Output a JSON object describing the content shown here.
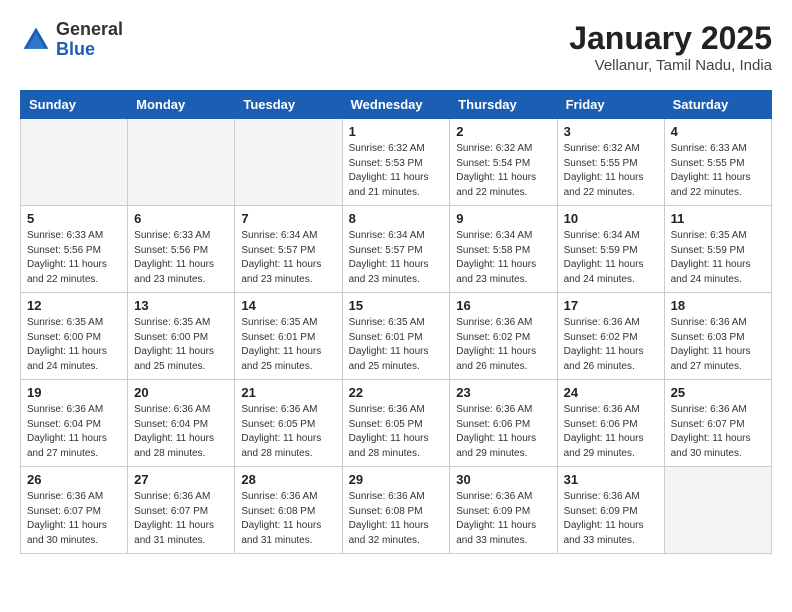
{
  "header": {
    "logo_line1": "General",
    "logo_line2": "Blue",
    "title": "January 2025",
    "subtitle": "Vellanur, Tamil Nadu, India"
  },
  "weekdays": [
    "Sunday",
    "Monday",
    "Tuesday",
    "Wednesday",
    "Thursday",
    "Friday",
    "Saturday"
  ],
  "weeks": [
    [
      {
        "day": "",
        "info": ""
      },
      {
        "day": "",
        "info": ""
      },
      {
        "day": "",
        "info": ""
      },
      {
        "day": "1",
        "info": "Sunrise: 6:32 AM\nSunset: 5:53 PM\nDaylight: 11 hours\nand 21 minutes."
      },
      {
        "day": "2",
        "info": "Sunrise: 6:32 AM\nSunset: 5:54 PM\nDaylight: 11 hours\nand 22 minutes."
      },
      {
        "day": "3",
        "info": "Sunrise: 6:32 AM\nSunset: 5:55 PM\nDaylight: 11 hours\nand 22 minutes."
      },
      {
        "day": "4",
        "info": "Sunrise: 6:33 AM\nSunset: 5:55 PM\nDaylight: 11 hours\nand 22 minutes."
      }
    ],
    [
      {
        "day": "5",
        "info": "Sunrise: 6:33 AM\nSunset: 5:56 PM\nDaylight: 11 hours\nand 22 minutes."
      },
      {
        "day": "6",
        "info": "Sunrise: 6:33 AM\nSunset: 5:56 PM\nDaylight: 11 hours\nand 23 minutes."
      },
      {
        "day": "7",
        "info": "Sunrise: 6:34 AM\nSunset: 5:57 PM\nDaylight: 11 hours\nand 23 minutes."
      },
      {
        "day": "8",
        "info": "Sunrise: 6:34 AM\nSunset: 5:57 PM\nDaylight: 11 hours\nand 23 minutes."
      },
      {
        "day": "9",
        "info": "Sunrise: 6:34 AM\nSunset: 5:58 PM\nDaylight: 11 hours\nand 23 minutes."
      },
      {
        "day": "10",
        "info": "Sunrise: 6:34 AM\nSunset: 5:59 PM\nDaylight: 11 hours\nand 24 minutes."
      },
      {
        "day": "11",
        "info": "Sunrise: 6:35 AM\nSunset: 5:59 PM\nDaylight: 11 hours\nand 24 minutes."
      }
    ],
    [
      {
        "day": "12",
        "info": "Sunrise: 6:35 AM\nSunset: 6:00 PM\nDaylight: 11 hours\nand 24 minutes."
      },
      {
        "day": "13",
        "info": "Sunrise: 6:35 AM\nSunset: 6:00 PM\nDaylight: 11 hours\nand 25 minutes."
      },
      {
        "day": "14",
        "info": "Sunrise: 6:35 AM\nSunset: 6:01 PM\nDaylight: 11 hours\nand 25 minutes."
      },
      {
        "day": "15",
        "info": "Sunrise: 6:35 AM\nSunset: 6:01 PM\nDaylight: 11 hours\nand 25 minutes."
      },
      {
        "day": "16",
        "info": "Sunrise: 6:36 AM\nSunset: 6:02 PM\nDaylight: 11 hours\nand 26 minutes."
      },
      {
        "day": "17",
        "info": "Sunrise: 6:36 AM\nSunset: 6:02 PM\nDaylight: 11 hours\nand 26 minutes."
      },
      {
        "day": "18",
        "info": "Sunrise: 6:36 AM\nSunset: 6:03 PM\nDaylight: 11 hours\nand 27 minutes."
      }
    ],
    [
      {
        "day": "19",
        "info": "Sunrise: 6:36 AM\nSunset: 6:04 PM\nDaylight: 11 hours\nand 27 minutes."
      },
      {
        "day": "20",
        "info": "Sunrise: 6:36 AM\nSunset: 6:04 PM\nDaylight: 11 hours\nand 28 minutes."
      },
      {
        "day": "21",
        "info": "Sunrise: 6:36 AM\nSunset: 6:05 PM\nDaylight: 11 hours\nand 28 minutes."
      },
      {
        "day": "22",
        "info": "Sunrise: 6:36 AM\nSunset: 6:05 PM\nDaylight: 11 hours\nand 28 minutes."
      },
      {
        "day": "23",
        "info": "Sunrise: 6:36 AM\nSunset: 6:06 PM\nDaylight: 11 hours\nand 29 minutes."
      },
      {
        "day": "24",
        "info": "Sunrise: 6:36 AM\nSunset: 6:06 PM\nDaylight: 11 hours\nand 29 minutes."
      },
      {
        "day": "25",
        "info": "Sunrise: 6:36 AM\nSunset: 6:07 PM\nDaylight: 11 hours\nand 30 minutes."
      }
    ],
    [
      {
        "day": "26",
        "info": "Sunrise: 6:36 AM\nSunset: 6:07 PM\nDaylight: 11 hours\nand 30 minutes."
      },
      {
        "day": "27",
        "info": "Sunrise: 6:36 AM\nSunset: 6:07 PM\nDaylight: 11 hours\nand 31 minutes."
      },
      {
        "day": "28",
        "info": "Sunrise: 6:36 AM\nSunset: 6:08 PM\nDaylight: 11 hours\nand 31 minutes."
      },
      {
        "day": "29",
        "info": "Sunrise: 6:36 AM\nSunset: 6:08 PM\nDaylight: 11 hours\nand 32 minutes."
      },
      {
        "day": "30",
        "info": "Sunrise: 6:36 AM\nSunset: 6:09 PM\nDaylight: 11 hours\nand 33 minutes."
      },
      {
        "day": "31",
        "info": "Sunrise: 6:36 AM\nSunset: 6:09 PM\nDaylight: 11 hours\nand 33 minutes."
      },
      {
        "day": "",
        "info": ""
      }
    ]
  ]
}
